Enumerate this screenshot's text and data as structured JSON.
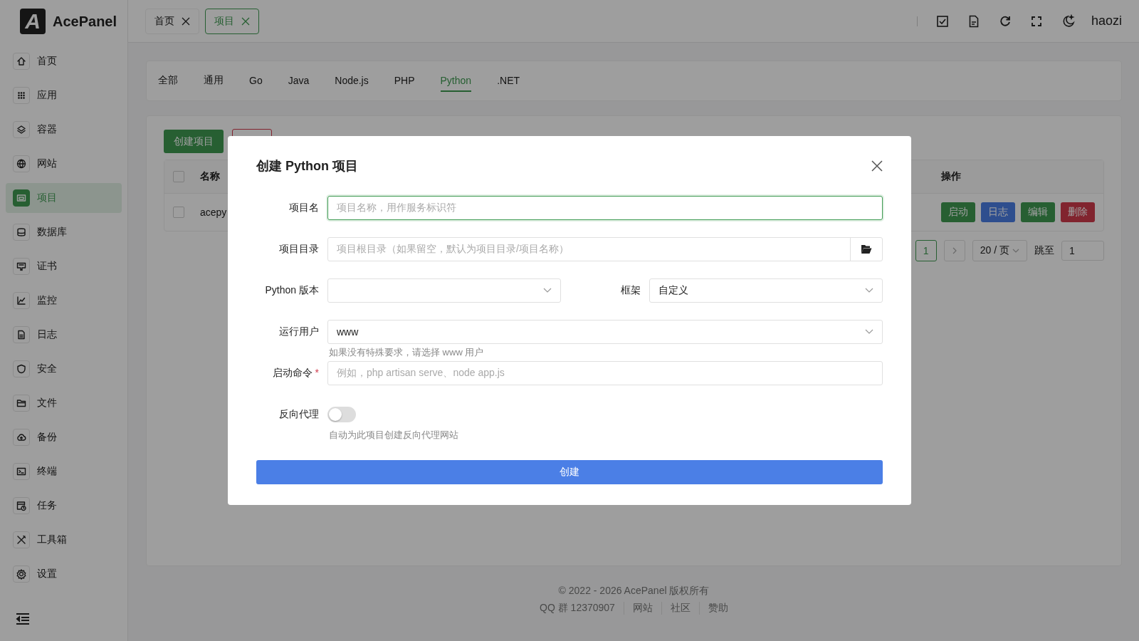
{
  "brand": {
    "logo_letter": "A",
    "name": "AcePanel"
  },
  "sidebar": {
    "items": [
      {
        "label": "首页",
        "selected": false
      },
      {
        "label": "应用",
        "selected": false
      },
      {
        "label": "容器",
        "selected": false
      },
      {
        "label": "网站",
        "selected": false
      },
      {
        "label": "项目",
        "selected": true
      },
      {
        "label": "数据库",
        "selected": false
      },
      {
        "label": "证书",
        "selected": false
      },
      {
        "label": "监控",
        "selected": false
      },
      {
        "label": "日志",
        "selected": false
      },
      {
        "label": "安全",
        "selected": false
      },
      {
        "label": "文件",
        "selected": false
      },
      {
        "label": "备份",
        "selected": false
      },
      {
        "label": "终端",
        "selected": false
      },
      {
        "label": "任务",
        "selected": false
      },
      {
        "label": "工具箱",
        "selected": false
      },
      {
        "label": "设置",
        "selected": false
      }
    ]
  },
  "header": {
    "tabs": [
      {
        "label": "首页",
        "selected": false
      },
      {
        "label": "项目",
        "selected": true
      }
    ],
    "user": "haozi"
  },
  "categories": [
    {
      "label": "全部",
      "selected": false
    },
    {
      "label": "通用",
      "selected": false
    },
    {
      "label": "Go",
      "selected": false
    },
    {
      "label": "Java",
      "selected": false
    },
    {
      "label": "Node.js",
      "selected": false
    },
    {
      "label": "PHP",
      "selected": false
    },
    {
      "label": "Python",
      "selected": true
    },
    {
      "label": ".NET",
      "selected": false
    }
  ],
  "toolbar": {
    "create_button": "创建项目"
  },
  "table": {
    "columns": [
      "名称",
      "操作"
    ],
    "all_checked": false,
    "rows": [
      {
        "checked": false,
        "name": "acepy",
        "actions": [
          {
            "label": "启动",
            "kind": "start"
          },
          {
            "label": "日志",
            "kind": "log"
          },
          {
            "label": "编辑",
            "kind": "edit"
          },
          {
            "label": "删除",
            "kind": "delete"
          }
        ]
      }
    ]
  },
  "pagination": {
    "pages": [
      {
        "label": "1",
        "selected": true
      }
    ],
    "page_size": "20 / 页",
    "jump_label": "跳至",
    "jump_value": "1"
  },
  "dialog": {
    "title": "创建 Python 项目",
    "fields": [
      {
        "kind": "text",
        "label": "项目名",
        "placeholder": "项目名称，用作服务标识符",
        "focused": true
      },
      {
        "kind": "path",
        "label": "项目目录",
        "placeholder": "项目根目录（如果留空，默认为项目目录/项目名称）"
      },
      {
        "kind": "select_pair",
        "label": "Python 版本",
        "second_label": "框架",
        "second_value": "自定义"
      },
      {
        "kind": "select",
        "label": "运行用户",
        "value": "www",
        "hint": "如果没有特殊要求，请选择 www 用户"
      },
      {
        "kind": "text",
        "label": "启动命令",
        "required_mark": "*",
        "placeholder": "例如，php artisan serve、node app.js",
        "focused": false
      },
      {
        "kind": "switch",
        "label": "反向代理",
        "on": false,
        "hint": "自动为此项目创建反向代理网站"
      }
    ],
    "submit": "创建"
  },
  "footer": {
    "copyright": "© 2022 - 2026 AcePanel 版权所有",
    "links": [
      "QQ 群 12370907",
      "网站",
      "社区",
      "赞助"
    ]
  }
}
